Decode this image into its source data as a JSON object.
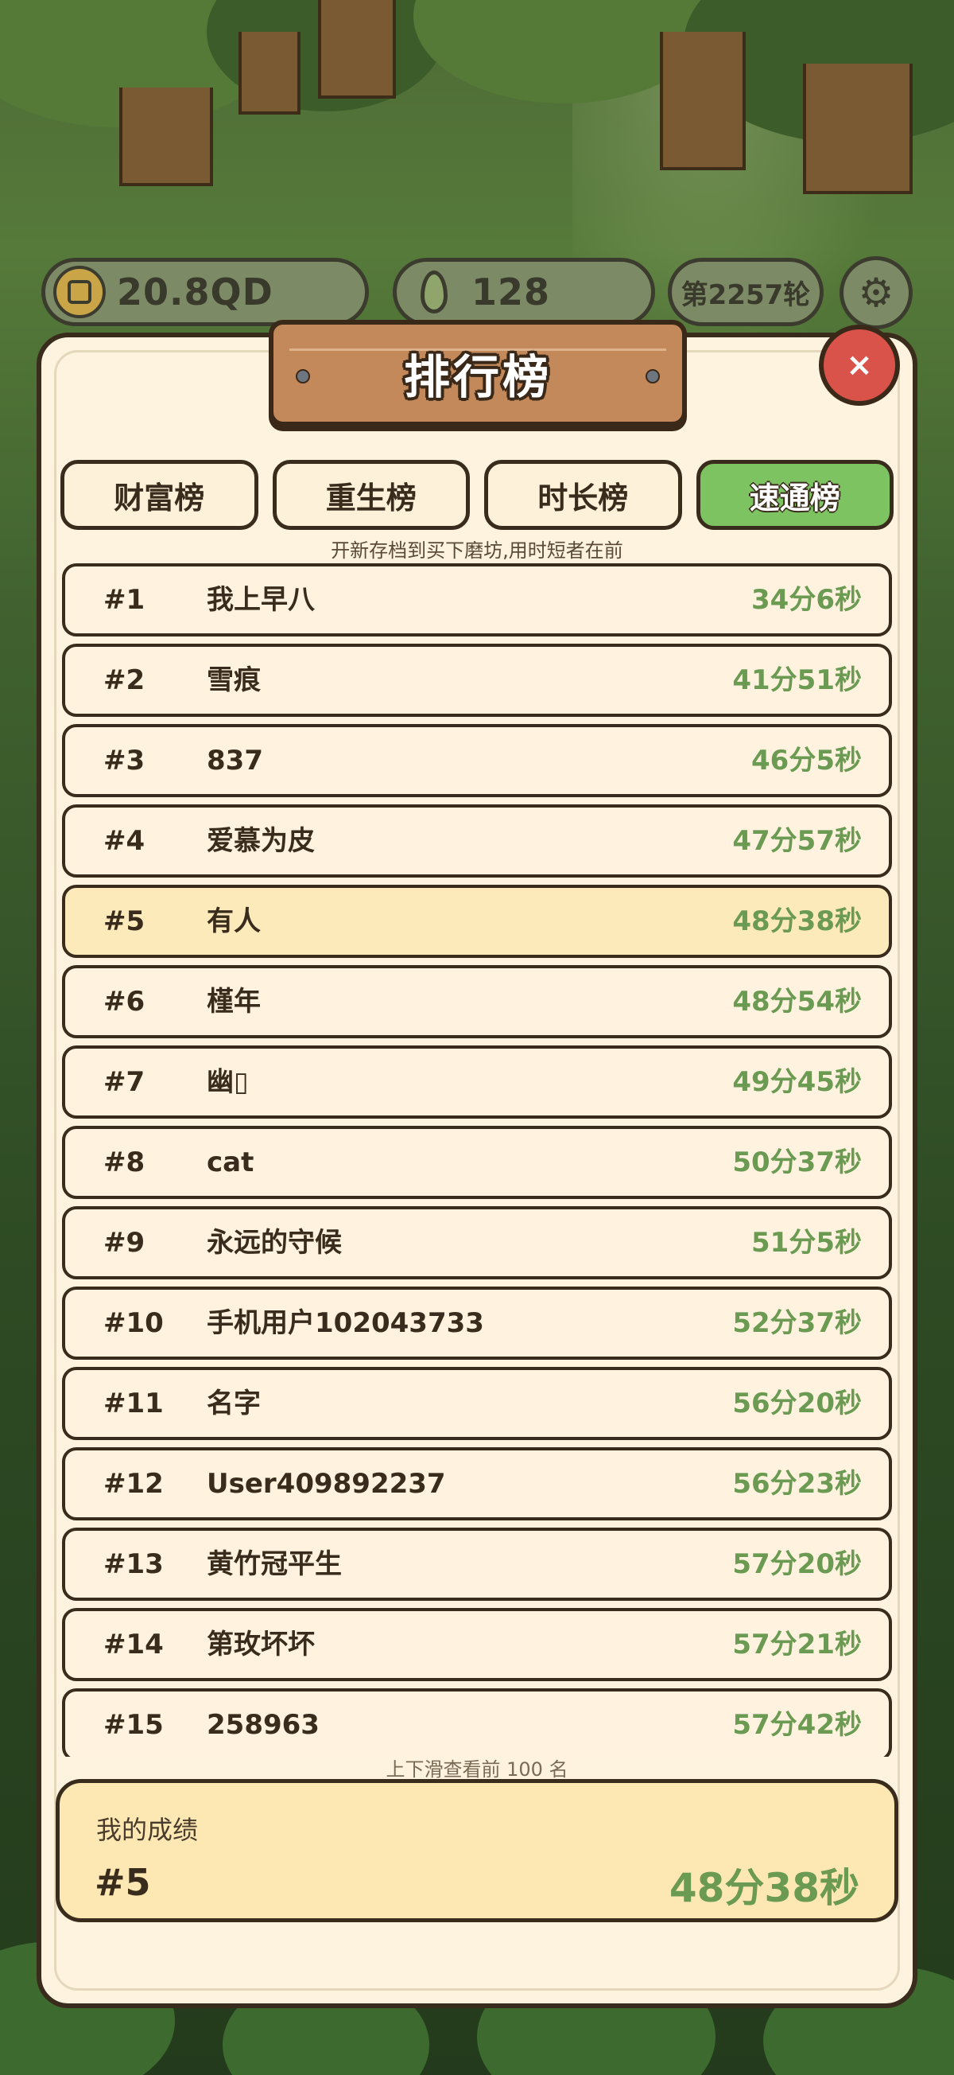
{
  "hud": {
    "coins": "20.8QD",
    "seeds": "128",
    "round": "第2257轮"
  },
  "title": "排行榜",
  "close_symbol": "×",
  "tabs": [
    {
      "label": "财富榜",
      "active": false
    },
    {
      "label": "重生榜",
      "active": false
    },
    {
      "label": "时长榜",
      "active": false
    },
    {
      "label": "速通榜",
      "active": true
    }
  ],
  "hint_top": "开新存档到买下磨坊,用时短者在前",
  "leaderboard": [
    {
      "rank": "#1",
      "name": "我上早八",
      "time": "34分6秒"
    },
    {
      "rank": "#2",
      "name": "雪痕",
      "time": "41分51秒"
    },
    {
      "rank": "#3",
      "name": "837",
      "time": "46分5秒"
    },
    {
      "rank": "#4",
      "name": "爱慕为皮",
      "time": "47分57秒"
    },
    {
      "rank": "#5",
      "name": "有人",
      "time": "48分38秒",
      "me": true
    },
    {
      "rank": "#6",
      "name": "槿年",
      "time": "48分54秒"
    },
    {
      "rank": "#7",
      "name": "幽▯",
      "time": "49分45秒"
    },
    {
      "rank": "#8",
      "name": "cat",
      "time": "50分37秒"
    },
    {
      "rank": "#9",
      "name": "永远的守候",
      "time": "51分5秒"
    },
    {
      "rank": "#10",
      "name": "手机用户102043733",
      "time": "52分37秒"
    },
    {
      "rank": "#11",
      "name": "名字",
      "time": "56分20秒"
    },
    {
      "rank": "#12",
      "name": "User409892237",
      "time": "56分23秒"
    },
    {
      "rank": "#13",
      "name": "黄竹冠平生",
      "time": "57分20秒"
    },
    {
      "rank": "#14",
      "name": "第玫坏坏",
      "time": "57分21秒"
    },
    {
      "rank": "#15",
      "name": "258963",
      "time": "57分42秒"
    }
  ],
  "hint_bottom": "上下滑查看前 100 名",
  "my_score": {
    "label": "我的成绩",
    "rank": "#5",
    "time": "48分38秒"
  },
  "colors": {
    "active_tab": "#7dc362",
    "time_text": "#6b9a52",
    "highlight_row": "#fdeaba",
    "close_button": "#d9534a"
  }
}
